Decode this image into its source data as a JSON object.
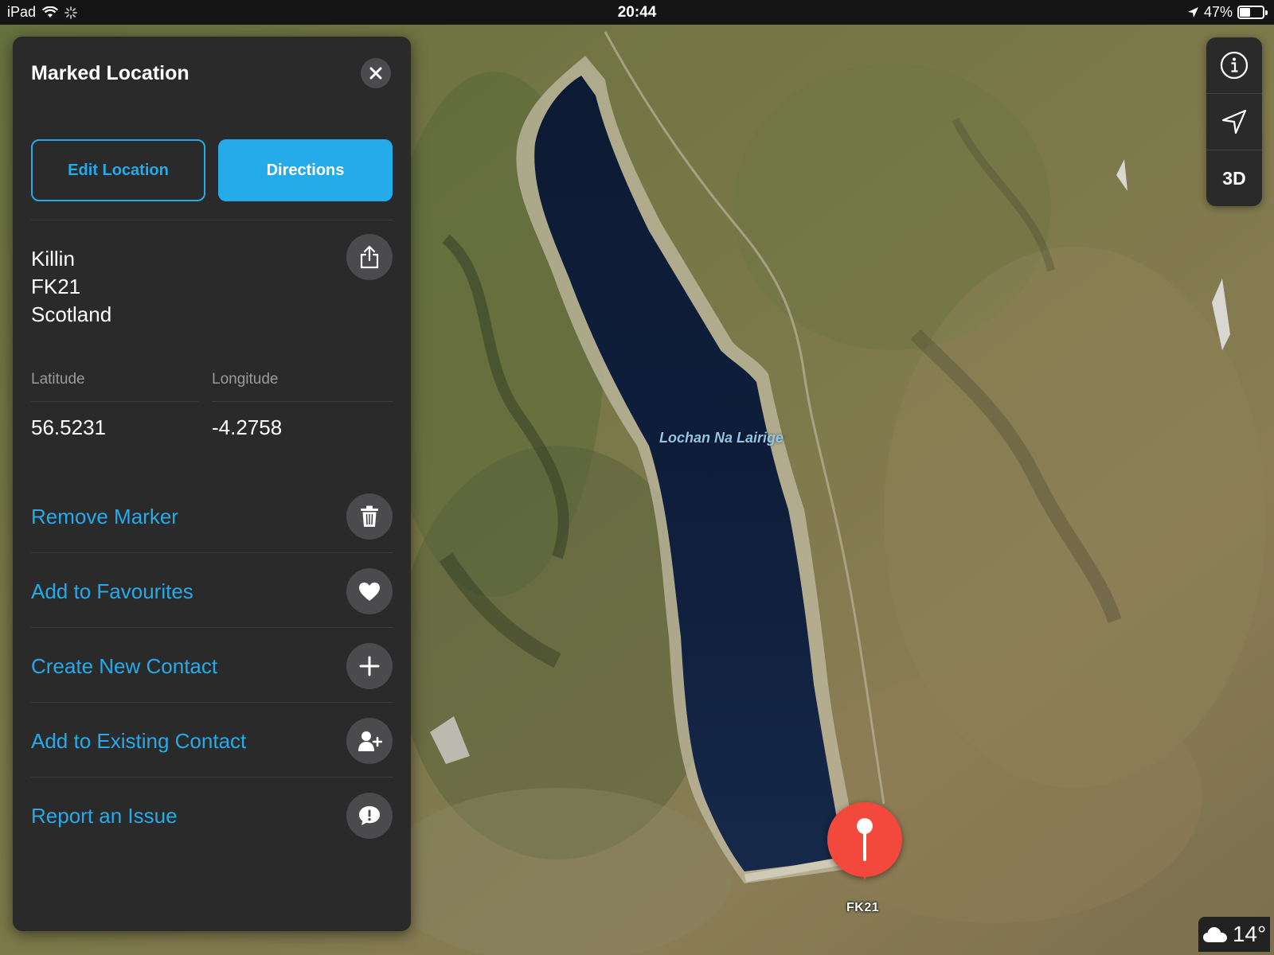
{
  "status_bar": {
    "device": "iPad",
    "time": "20:44",
    "battery": "47%",
    "battery_level": 0.47
  },
  "panel": {
    "title": "Marked Location",
    "edit_label": "Edit Location",
    "directions_label": "Directions",
    "address": [
      "Killin",
      "FK21",
      "Scotland"
    ],
    "latitude_label": "Latitude",
    "longitude_label": "Longitude",
    "latitude": "56.5231",
    "longitude": "-4.2758",
    "actions": [
      {
        "label": "Remove Marker",
        "icon": "trash-icon"
      },
      {
        "label": "Add to Favourites",
        "icon": "heart-icon"
      },
      {
        "label": "Create New Contact",
        "icon": "plus-icon"
      },
      {
        "label": "Add to Existing Contact",
        "icon": "add-person-icon"
      },
      {
        "label": "Report an Issue",
        "icon": "exclamation-bubble-icon"
      }
    ]
  },
  "map": {
    "lake_label": "Lochan Na Lairige",
    "pin_label": "FK21"
  },
  "controls": {
    "view_3d": "3D"
  },
  "weather": {
    "temperature": "14°",
    "icon": "cloud-icon"
  },
  "colors": {
    "accent": "#25aaea",
    "panel": "#2a2a2b",
    "pin": "#f2493c"
  }
}
